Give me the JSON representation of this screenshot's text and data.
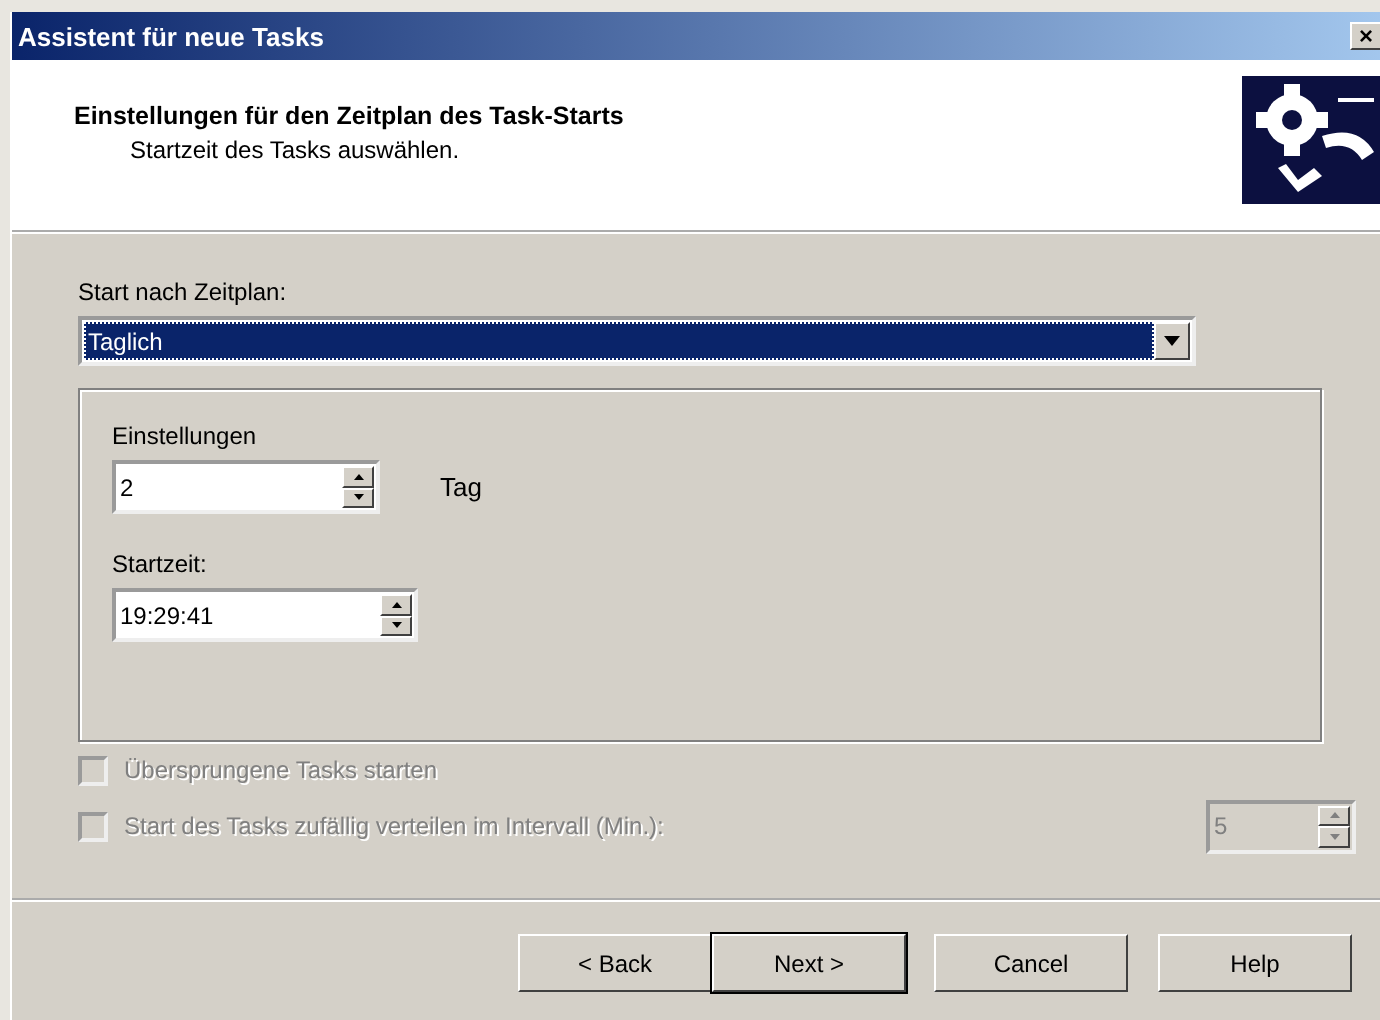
{
  "window": {
    "title": "Assistent für neue Tasks",
    "close": "×"
  },
  "header": {
    "title": "Einstellungen für den Zeitplan des Task-Starts",
    "subtitle": "Startzeit des Tasks auswählen."
  },
  "schedule": {
    "label": "Start nach Zeitplan:",
    "value": "Taglich"
  },
  "settings": {
    "label": "Einstellungen",
    "value": "2",
    "unit": "Tag",
    "time_label": "Startzeit:",
    "time_value": "19:29:41"
  },
  "options": [
    {
      "label": "Übersprungene Tasks starten",
      "checked": false,
      "disabled": true
    },
    {
      "label": "Start des Tasks zufällig verteilen im Intervall (Min.):",
      "checked": false,
      "disabled": true,
      "value": "5"
    }
  ],
  "buttons": [
    {
      "label": "< Back",
      "default": false
    },
    {
      "label": "Next >",
      "default": true
    },
    {
      "label": "Cancel",
      "default": false
    },
    {
      "label": "Help",
      "default": false
    }
  ]
}
